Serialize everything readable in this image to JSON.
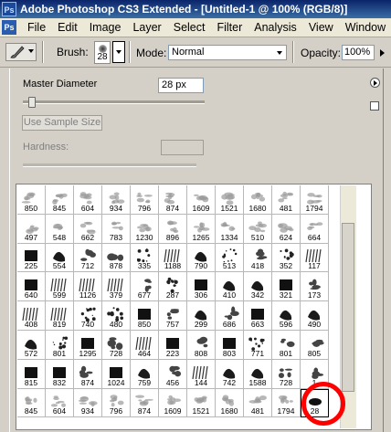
{
  "window": {
    "title": "Adobe Photoshop CS3 Extended - [Untitled-1 @ 100% (RGB/8)]",
    "logo_text": "Ps"
  },
  "menubar": {
    "app_badge": "Ps",
    "items": [
      "File",
      "Edit",
      "Image",
      "Layer",
      "Select",
      "Filter",
      "Analysis",
      "View",
      "Window",
      "H"
    ]
  },
  "options": {
    "brush_label": "Brush:",
    "brush_size": "28",
    "mode_label": "Mode:",
    "mode_value": "Normal",
    "opacity_label": "Opacity:",
    "opacity_value": "100%"
  },
  "brush_panel": {
    "master_diameter_label": "Master Diameter",
    "master_diameter_value": "28 px",
    "master_diameter_slider_fraction": 0.05,
    "sample_button": "Use Sample Size",
    "hardness_label": "Hardness:"
  },
  "brush_grid": {
    "rows": [
      [
        "850",
        "845",
        "604",
        "934",
        "796",
        "874",
        "1609",
        "1521",
        "1680",
        "481",
        "1794"
      ],
      [
        "497",
        "548",
        "662",
        "783",
        "1230",
        "896",
        "1265",
        "1334",
        "510",
        "624",
        "664"
      ],
      [
        "225",
        "554",
        "712",
        "878",
        "335",
        "1188",
        "790",
        "513",
        "418",
        "352",
        "117"
      ],
      [
        "640",
        "599",
        "1126",
        "379",
        "677",
        "287",
        "306",
        "410",
        "342",
        "321",
        "173"
      ],
      [
        "408",
        "819",
        "740",
        "480",
        "850",
        "757",
        "299",
        "686",
        "663",
        "596",
        "490"
      ],
      [
        "572",
        "801",
        "1295",
        "728",
        "464",
        "223",
        "808",
        "803",
        "771",
        "801",
        "805"
      ],
      [
        "815",
        "832",
        "874",
        "1024",
        "759",
        "456",
        "144",
        "742",
        "1588",
        "728",
        "1"
      ],
      [
        "845",
        "604",
        "934",
        "796",
        "874",
        "1609",
        "1521",
        "1680",
        "481",
        "1794",
        "28"
      ]
    ],
    "selected_size": "28"
  },
  "colors": {
    "title_bar": "#0a246a",
    "highlight": "#ff0000"
  }
}
